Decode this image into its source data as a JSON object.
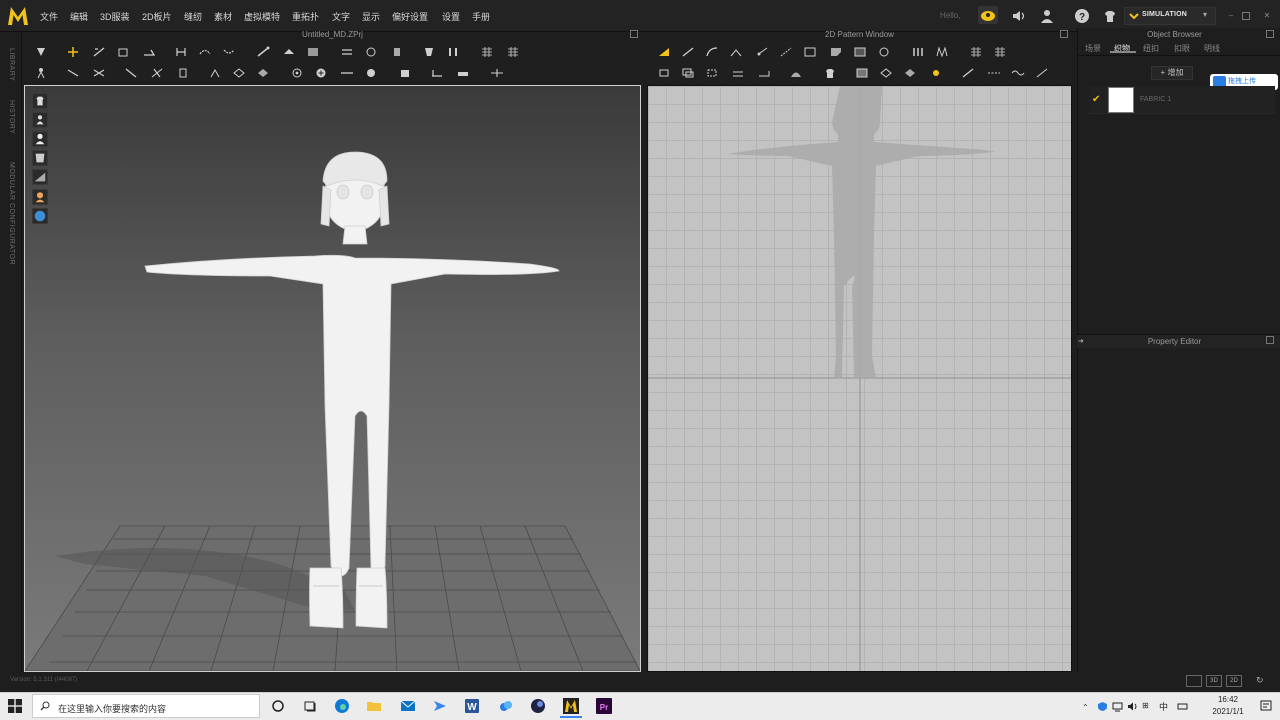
{
  "menu": [
    "文件",
    "编辑",
    "3D服装",
    "2D板片",
    "缝纫",
    "素材",
    "虚拟模特",
    "重拓扑",
    "文字",
    "显示",
    "偏好设置",
    "设置",
    "手册"
  ],
  "user_greeting": "Hello,",
  "mode": {
    "label": "SIMULATION"
  },
  "left_sidebar": [
    "LIBRARY",
    "HISTORY",
    "MODULAR CONFIGURATOR"
  ],
  "panels": {
    "viewport_3d": {
      "title": "Untitled_MD.ZPrj"
    },
    "pattern_2d": {
      "title": "2D Pattern Window"
    },
    "object_browser": {
      "title": "Object Browser",
      "tabs": [
        "场景",
        "织物",
        "纽扣",
        "扣眼",
        "明线"
      ],
      "active_tab": 1,
      "add_label": "+ 增加",
      "fabrics": [
        {
          "name": "FABRIC 1",
          "color": "#ffffff",
          "checked": true
        }
      ]
    },
    "property_editor": {
      "title": "Property Editor"
    }
  },
  "upload_button": "拖拽上传",
  "version": "Version: 5.1.311 (r44087)",
  "view_modes": [
    "",
    "3D",
    "2D"
  ],
  "taskbar": {
    "search_placeholder": "在这里输入你要搜索的内容",
    "ime": "中",
    "time": "16:42",
    "date": "2021/1/1"
  },
  "colors": {
    "accent": "#f0c000",
    "upload_blue": "#2a7de1",
    "panel_bg": "#1e1e1e"
  }
}
